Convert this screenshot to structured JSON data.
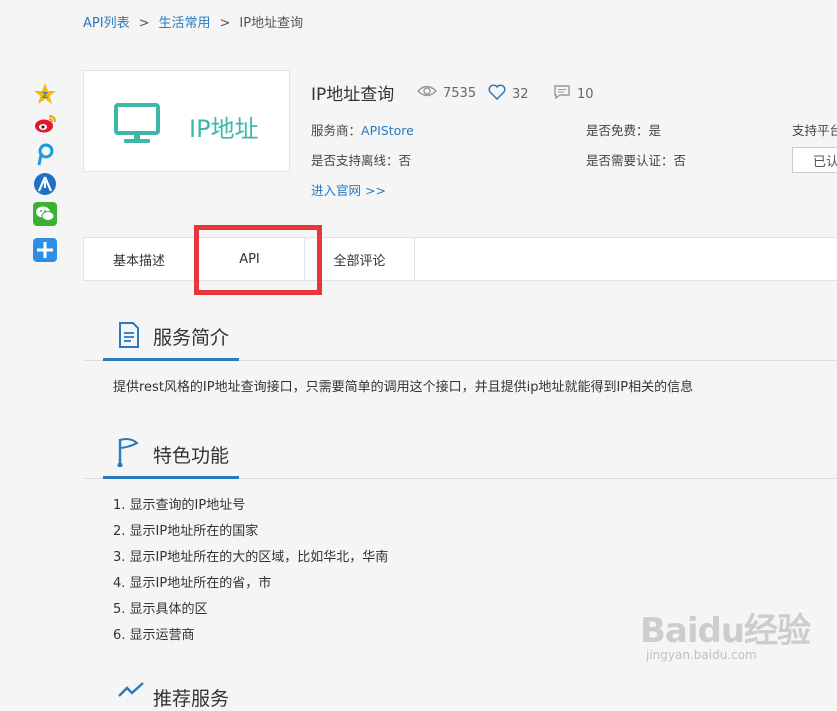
{
  "breadcrumb": {
    "items": [
      "API列表",
      "生活常用",
      "IP地址查询"
    ],
    "separator": ">"
  },
  "share_icons": [
    "qzone-icon",
    "weibo-icon",
    "pengyou-icon",
    "renren-icon",
    "wechat-icon",
    "plus-icon"
  ],
  "logo": {
    "text": "IP地址",
    "icon": "monitor-icon"
  },
  "api": {
    "title": "IP地址查询",
    "views": "7535",
    "likes": "32",
    "comments": "10"
  },
  "meta": {
    "provider_label": "服务商：",
    "provider_value": "APIStore",
    "free_label": "是否免费：",
    "free_value": "是",
    "platform_label": "支持平台",
    "offline_label": "是否支持离线：",
    "offline_value": "否",
    "auth_label": "是否需要认证：",
    "auth_value": "否",
    "official_link": "进入官网 >>",
    "authorized_button": "已认"
  },
  "tabs": [
    "基本描述",
    "API",
    "全部评论"
  ],
  "sections": {
    "intro_title": "服务简介",
    "intro_text": "提供rest风格的IP地址查询接口，只需要简单的调用这个接口，并且提供ip地址就能得到IP相关的信息",
    "features_title": "特色功能",
    "features": [
      "1. 显示查询的IP地址号",
      "2. 显示IP地址所在的国家",
      "3. 显示IP地址所在的大的区域，比如华北，华南",
      "4. 显示IP地址所在的省，市",
      "5. 显示具体的区",
      "6. 显示运营商"
    ],
    "recommend_title": "推荐服务"
  },
  "watermark": {
    "main": "Baidu经验",
    "sub": "jingyan.baidu.com"
  },
  "colors": {
    "accent": "#2a7ac0",
    "logo_teal": "#3db8a8",
    "highlight_red": "#e8373b"
  }
}
